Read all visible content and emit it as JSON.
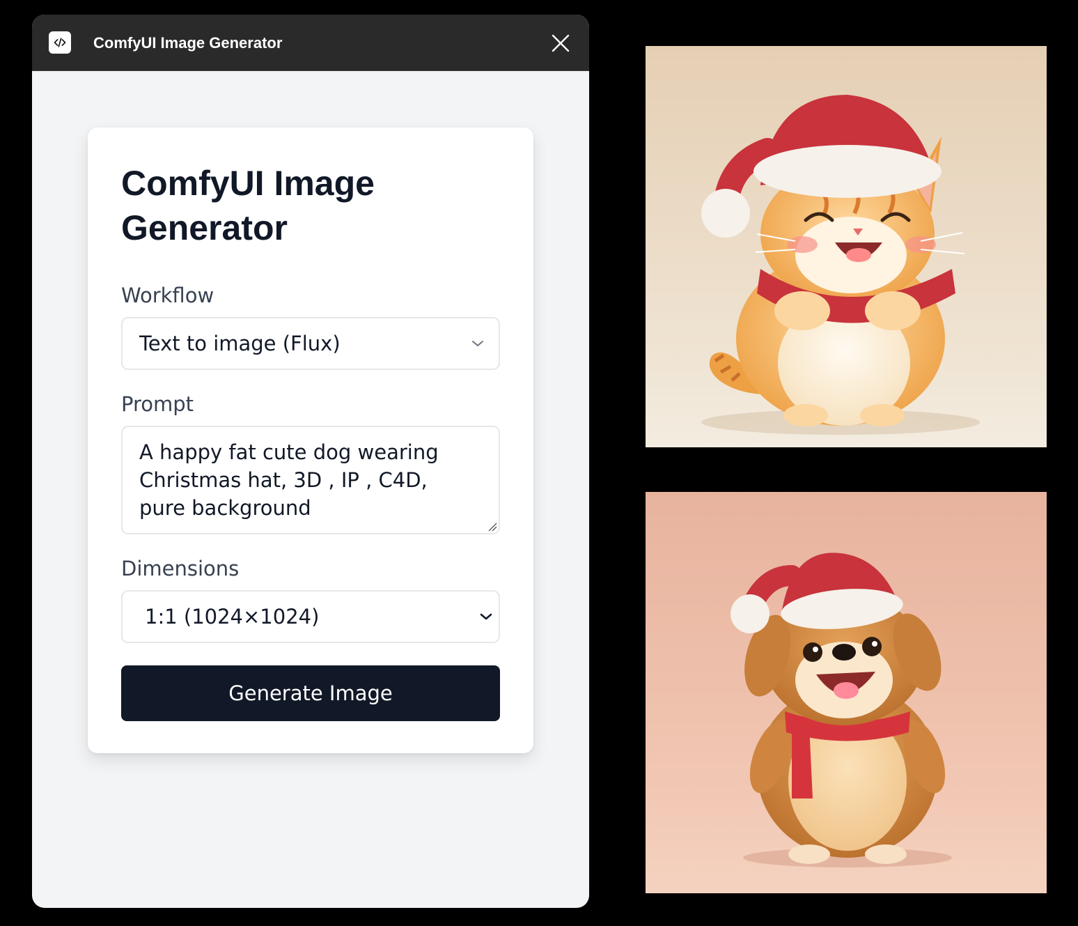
{
  "window": {
    "title": "ComfyUI Image Generator",
    "icon": "code-brackets-icon",
    "close_icon": "close-icon"
  },
  "form": {
    "heading": "ComfyUI Image Generator",
    "workflow": {
      "label": "Workflow",
      "selected": "Text to image (Flux)"
    },
    "prompt": {
      "label": "Prompt",
      "value": "A happy fat cute dog wearing Christmas hat, 3D , IP , C4D, pure background"
    },
    "dimensions": {
      "label": "Dimensions",
      "selected": "1:1 (1024×1024)"
    },
    "generate_label": "Generate Image"
  },
  "colors": {
    "titlebar": "#2a2a2a",
    "window_bg": "#f3f4f6",
    "card_bg": "#ffffff",
    "button_bg": "#111827",
    "heading": "#111827"
  }
}
